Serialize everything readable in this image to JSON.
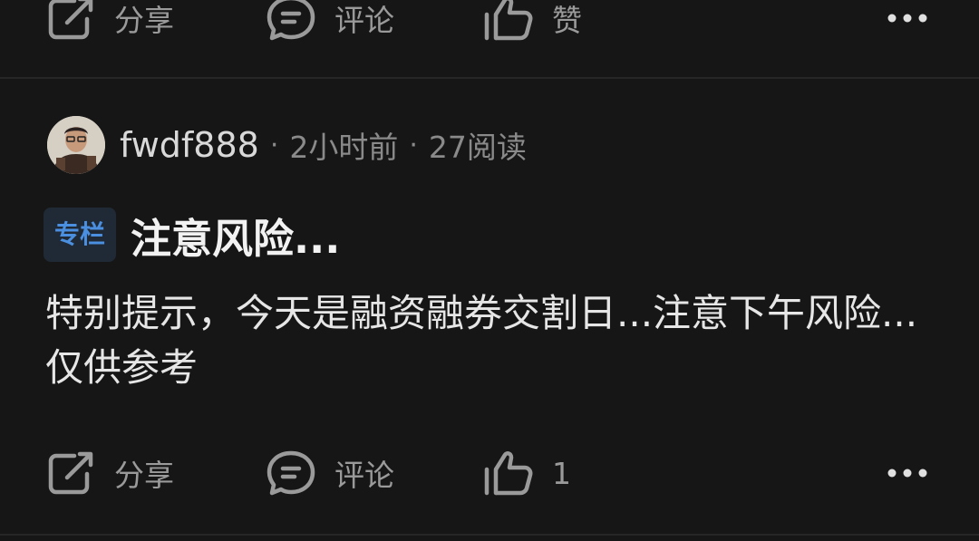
{
  "top_actions": {
    "share_label": "分享",
    "comment_label": "评论",
    "like_label": "赞"
  },
  "post": {
    "author": "fwdf888",
    "time": "2小时前",
    "reads": "27阅读",
    "badge": "专栏",
    "title": "注意风险...",
    "body": "特别提示，今天是融资融券交割日...注意下午风险...仅供参考",
    "actions": {
      "share_label": "分享",
      "comment_label": "评论",
      "like_count": "1"
    }
  },
  "colors": {
    "background": "#161616",
    "badge_text": "#4a8fe0",
    "badge_bg": "#202a36",
    "muted": "#9a9a9a"
  },
  "icons": [
    "share-icon",
    "comment-icon",
    "like-icon",
    "more-icon"
  ]
}
